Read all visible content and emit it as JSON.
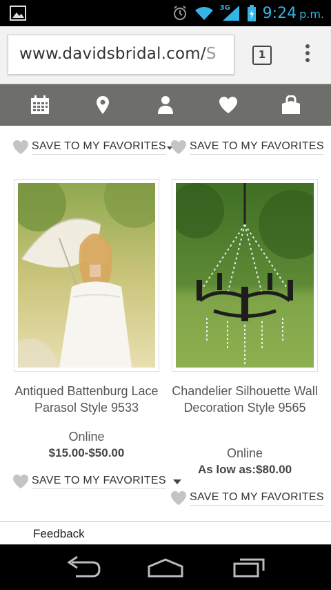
{
  "status_bar": {
    "time": "9:24",
    "ampm": "p.m.",
    "network": "3G",
    "icons": [
      "gallery-icon",
      "alarm-icon",
      "wifi-icon",
      "signal-icon",
      "battery-icon"
    ],
    "accent_color": "#33b5e5"
  },
  "browser": {
    "url_main": "www.davidsbridal.com/",
    "url_rest": "S",
    "tab_count": "1"
  },
  "nav": {
    "items": [
      "calendar-icon",
      "location-pin-icon",
      "account-icon",
      "favorites-heart-icon",
      "shopping-bag-icon"
    ],
    "bg_color": "#6e6e6a"
  },
  "products": [
    {
      "top_favorite": "SAVE TO MY FAVORITES",
      "title": "Antiqued Battenburg Lace Parasol Style 9533",
      "availability": "Online",
      "price": "$15.00-$50.00",
      "bottom_favorite": "SAVE TO MY FAVORITES"
    },
    {
      "top_favorite": "SAVE TO MY FAVORITES",
      "title": "Chandelier Silhouette Wall Decoration Style 9565",
      "availability": "Online",
      "price": "As low as:$80.00",
      "bottom_favorite": "SAVE TO MY FAVORITES"
    }
  ],
  "feedback": {
    "label": "Feedback"
  }
}
